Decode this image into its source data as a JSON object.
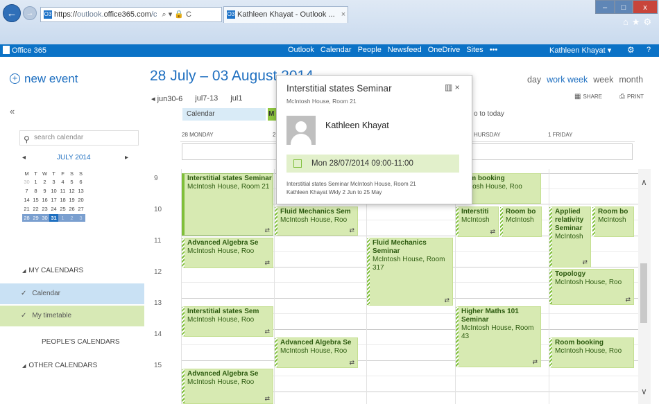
{
  "browser": {
    "address_prefix": "https://",
    "address_host_dim": "outlook.",
    "address_host": "office365.com",
    "address_suffix": "/c",
    "address_icons": "⌕ ▾ 🔒 C",
    "tab_title": "Kathleen Khayat - Outlook ...",
    "tab_close": "×",
    "favicon_text": "O3",
    "window_min": "–",
    "window_max": "□",
    "window_close": "x",
    "toolbar_icons": "⌂★⚙"
  },
  "o365": {
    "brand": "Office 365",
    "nav": [
      "Outlook",
      "Calendar",
      "People",
      "Newsfeed",
      "OneDrive",
      "Sites",
      "•••"
    ],
    "active_nav": "Calendar",
    "user": "Kathleen Khayat ▾",
    "settings_icon": "⚙",
    "help": "?"
  },
  "left": {
    "new_event": "new event",
    "collapse": "«",
    "search_placeholder": "search calendar",
    "minical_title": "JULY 2014",
    "minical_prev": "◂",
    "minical_next": "▸",
    "weekdays": [
      "M",
      "T",
      "W",
      "T",
      "F",
      "S",
      "S"
    ],
    "weeks": [
      [
        "30",
        "1",
        "2",
        "3",
        "4",
        "5",
        "6"
      ],
      [
        "7",
        "8",
        "9",
        "10",
        "11",
        "12",
        "13"
      ],
      [
        "14",
        "15",
        "16",
        "17",
        "18",
        "19",
        "20"
      ],
      [
        "21",
        "22",
        "23",
        "24",
        "25",
        "26",
        "27"
      ],
      [
        "28",
        "29",
        "30",
        "31",
        "1",
        "2",
        "3"
      ]
    ],
    "today": "31",
    "my_calendars": "MY CALENDARS",
    "calendar_item": "Calendar",
    "timetable_item": "My timetable",
    "peoples_calendars": "PEOPLE'S CALENDARS",
    "other_calendars": "OTHER CALENDARS"
  },
  "header": {
    "date_range": "28 July – 03 August 2014",
    "week_links": [
      "◂ jun30-6",
      "jul7-13",
      "jul1"
    ],
    "views": [
      "day",
      "work week",
      "week",
      "month"
    ],
    "active_view": "work week",
    "share": "SHARE",
    "print": "PRINT",
    "filter_calendar": "Calendar",
    "filter_timetable": "M",
    "go_to_today": "o to today",
    "day_headers": [
      "28 MONDAY",
      "2",
      "HURSDAY",
      "1 FRIDAY"
    ]
  },
  "grid": {
    "hours": [
      "9",
      "10",
      "11",
      "12",
      "13",
      "14",
      "15"
    ]
  },
  "events": [
    {
      "id": "e1",
      "title": "Interstitial states Seminar",
      "loc": "McIntosh House, Room 21",
      "sync": true
    },
    {
      "id": "e2",
      "title": "Advanced Algebra Se",
      "loc": "McIntosh House, Roo",
      "sync": true
    },
    {
      "id": "e3",
      "title": "Interstitial states Sem",
      "loc": "McIntosh House, Roo",
      "sync": true
    },
    {
      "id": "e4",
      "title": "Advanced Algebra Se",
      "loc": "McIntosh House, Roo",
      "sync": true
    },
    {
      "id": "e5",
      "title": "Fluid Mechanics Sem",
      "loc": "McIntosh House, Roo",
      "sync": true
    },
    {
      "id": "e6",
      "title": "Advanced Algebra Se",
      "loc": "McIntosh House, Roo",
      "sync": true
    },
    {
      "id": "e7",
      "title": "Fluid Mechanics Seminar",
      "loc": "McIntosh House, Room 317",
      "sync": true
    },
    {
      "id": "e8",
      "title": "oom booking",
      "loc": "cIntosh House, Roo",
      "sync": false
    },
    {
      "id": "e9",
      "title": "Interstiti",
      "loc": "McIntosh",
      "sync": true
    },
    {
      "id": "e10",
      "title": "Room bo",
      "loc": "McIntosh",
      "sync": false
    },
    {
      "id": "e11",
      "title": "Higher Maths 101 Seminar",
      "loc": "McIntosh House, Room 43",
      "sync": true
    },
    {
      "id": "e12",
      "title": "Applied relativity Seminar",
      "loc": "McIntosh",
      "sync": true
    },
    {
      "id": "e13",
      "title": "Room bo",
      "loc": "McIntosh",
      "sync": false
    },
    {
      "id": "e14",
      "title": "Topology",
      "loc": "McIntosh House, Roo",
      "sync": true
    },
    {
      "id": "e15",
      "title": "Room booking",
      "loc": "McIntosh House, Roo",
      "sync": false
    }
  ],
  "sync_icon": "⇄",
  "popup": {
    "title": "Interstitial states Seminar",
    "location": "McIntosh House, Room 21",
    "icons": "▥ ×",
    "organizer": "Kathleen Khayat",
    "time": "Mon 28/07/2014 09:00-11:00",
    "desc_line1": "Interstitial states Seminar McIntosh House, Room 21",
    "desc_line2": "Kathleen Khayat Wkly 2 Jun to 25 May"
  },
  "scroll": {
    "up": "∧",
    "down": "∨"
  },
  "colors": {
    "accent": "#1e6fc0",
    "o365_bar": "#0b72c6",
    "event_fill": "#d7eab2",
    "event_stripe": "#7fbf3a"
  }
}
